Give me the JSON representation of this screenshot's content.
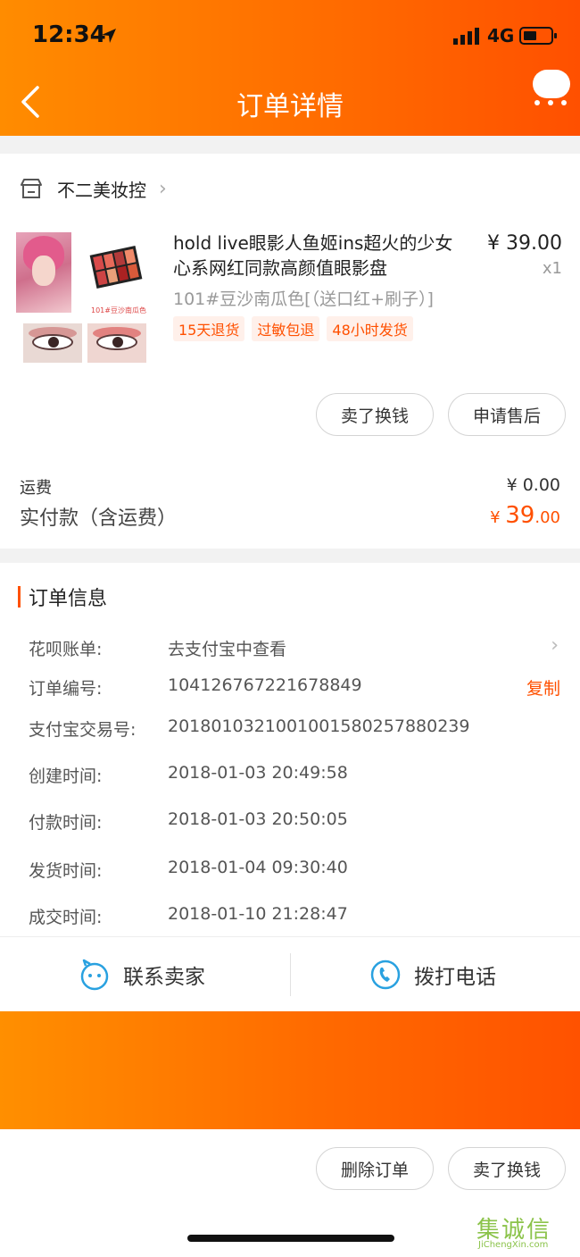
{
  "status_bar": {
    "time": "12:34",
    "network": "4G"
  },
  "header": {
    "title": "订单详情"
  },
  "shop": {
    "name": "不二美妆控"
  },
  "product": {
    "title": "hold live眼影人鱼姬ins超火的少女心系网红同款高颜值眼影盘",
    "price": "¥ 39.00",
    "quantity": "x1",
    "sku": "101#豆沙南瓜色[（送口红+刷子）]",
    "image_caption": "101#豆沙南瓜色",
    "tags": [
      "15天退货",
      "过敏包退",
      "48小时发货"
    ]
  },
  "item_actions": {
    "sell": "卖了换钱",
    "after_sale": "申请售后"
  },
  "fees": {
    "shipping_label": "运费",
    "shipping_value": "¥ 0.00",
    "paid_label": "实付款（含运费）",
    "paid_currency": "¥ ",
    "paid_int": "39",
    "paid_dec": ".00"
  },
  "order_info": {
    "title": "订单信息",
    "rows": [
      {
        "key": "花呗账单:",
        "value": "去支付宝中查看"
      },
      {
        "key": "订单编号:",
        "value": "104126767221678849",
        "action": "复制"
      },
      {
        "key": "支付宝交易号:",
        "value": "2018010321001001580257880239"
      },
      {
        "key": "创建时间:",
        "value": "2018-01-03 20:49:58"
      },
      {
        "key": "付款时间:",
        "value": "2018-01-03 20:50:05"
      },
      {
        "key": "发货时间:",
        "value": "2018-01-04 09:30:40"
      },
      {
        "key": "成交时间:",
        "value": "2018-01-10 21:28:47"
      }
    ]
  },
  "contact": {
    "seller": "联系卖家",
    "phone": "拨打电话"
  },
  "footer": {
    "delete": "删除订单",
    "sell": "卖了换钱"
  },
  "watermark": {
    "zh": "集诚信",
    "en": "JiChengXin.com"
  },
  "colors": {
    "accent": "#ff5000",
    "header_start": "#ff8c00",
    "header_end": "#ff5000",
    "icon_blue": "#29a1e0"
  }
}
